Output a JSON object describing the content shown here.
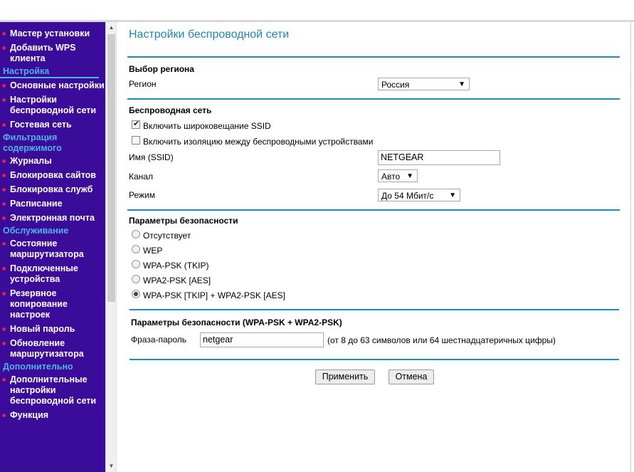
{
  "sidebar": {
    "top_items": [
      "Мастер установки",
      "Добавить WPS клиента"
    ],
    "section_setup": "Настройка",
    "setup_items": [
      "Основные настройки",
      "Настройки беспроводной сети",
      "Гостевая сеть"
    ],
    "section_content": "Фильтрация содержимого",
    "content_items": [
      "Журналы",
      "Блокировка сайтов",
      "Блокировка служб",
      "Расписание",
      "Электронная почта"
    ],
    "section_maintenance": "Обслуживание",
    "maintenance_items": [
      "Состояние маршрутизатора",
      "Подключенные устройства",
      "Резервное копирование настроек",
      "Новый пароль",
      "Обновление маршрутизатора"
    ],
    "section_advanced": "Дополнительно",
    "advanced_items": [
      "Дополнительные настройки беспроводной сети",
      "Функция"
    ]
  },
  "page": {
    "title": "Настройки беспроводной сети",
    "region_section": "Выбор региона",
    "region_label": "Регион",
    "region_value": "Россия",
    "wireless_section": "Беспроводная сеть",
    "ssid_broadcast_label": "Включить широковещание SSID",
    "ssid_broadcast_checked": true,
    "isolation_label": "Включить изоляцию между беспроводными устройствами",
    "isolation_checked": false,
    "ssid_label": "Имя (SSID)",
    "ssid_value": "NETGEAR",
    "channel_label": "Канал",
    "channel_value": "Авто",
    "mode_label": "Режим",
    "mode_value": "До 54 Мбит/с",
    "security_section": "Параметры безопасности",
    "security_options": [
      "Отсутствует",
      "WEP",
      "WPA-PSK (TKIP)",
      "WPA2-PSK [AES]",
      "WPA-PSK [TKIP] + WPA2-PSK [AES]"
    ],
    "security_selected": "WPA-PSK [TKIP] + WPA2-PSK [AES]",
    "psk_section": "Параметры безопасности (WPA-PSK + WPA2-PSK)",
    "passphrase_label": "Фраза-пароль",
    "passphrase_value": "netgear",
    "passphrase_hint": "(от 8 до 63 символов или 64 шестнадцатеричных цифры)",
    "apply_button": "Применить",
    "cancel_button": "Отмена"
  },
  "colors": {
    "sidebar_bg": "#3b0b99",
    "section_accent": "#4fb3e8",
    "bullet": "#e0204a",
    "title": "#1d85b8",
    "divider": "#1c8db5"
  },
  "icons": {
    "bullet": "bullet-dot-icon",
    "scroll_up": "scroll-up-arrow-icon",
    "scroll_down": "scroll-down-arrow-icon",
    "dropdown": "dropdown-arrow-icon",
    "check": "checkmark-icon"
  }
}
